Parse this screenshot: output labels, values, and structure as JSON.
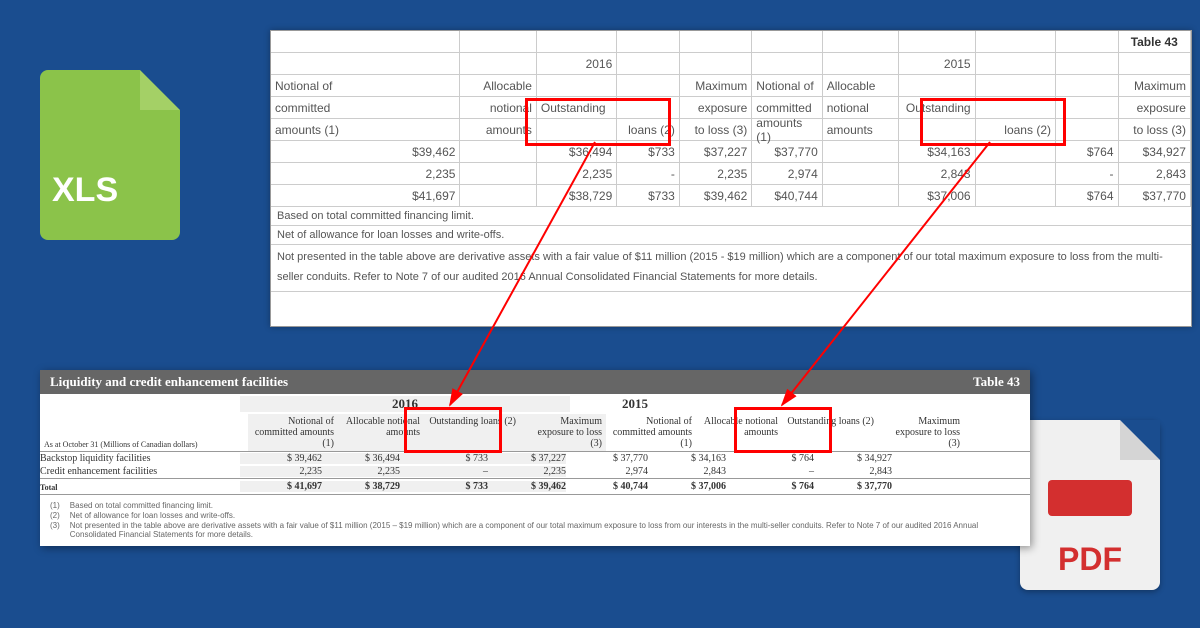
{
  "xls_label": "XLS",
  "pdf_label": "PDF",
  "top": {
    "table_label": "Table 43",
    "y1": "2016",
    "y2": "2015",
    "h": {
      "notional": "Notional of",
      "committed": "committed",
      "amounts1": "amounts (1)",
      "allocable": "Allocable",
      "notional_s": "notional",
      "amounts": "amounts",
      "outstanding": "Outstanding",
      "loans2": "loans (2)",
      "maximum": "Maximum",
      "exposure": "exposure",
      "loss3": "to loss (3)"
    },
    "r1": {
      "a": "$39,462",
      "b": "",
      "c": "$36,494",
      "d": "$733",
      "e": "$37,227",
      "f": "$37,770",
      "g": "",
      "h": "$34,163",
      "i": "$764",
      "j": "$34,927"
    },
    "r2": {
      "a": "2,235",
      "b": "",
      "c": "2,235",
      "d": "-",
      "e": "2,235",
      "f": "2,974",
      "g": "",
      "h": "2,843",
      "i": "-",
      "j": "2,843"
    },
    "r3": {
      "a": "$41,697",
      "b": "",
      "c": "$38,729",
      "d": "$733",
      "e": "$39,462",
      "f": "$40,744",
      "g": "",
      "h": "$37,006",
      "i": "$764",
      "j": "$37,770"
    },
    "n1": "Based on total committed financing limit.",
    "n2": "Net of allowance for loan losses and write-offs.",
    "n3": "Not presented in the table above are derivative assets with a fair value of $11 million (2015 - $19 million) which are a component of our total maximum exposure to loss from the multi-seller conduits. Refer to Note 7 of our audited 2016 Annual Consolidated Financial Statements for more details."
  },
  "bot": {
    "title": "Liquidity and credit enhancement facilities",
    "table_label": "Table 43",
    "y1": "2016",
    "y2": "2015",
    "asof": "As at October 31 (Millions of Canadian dollars)",
    "h": {
      "notional": "Notional of committed amounts",
      "allocable": "Allocable notional amounts",
      "outstanding": "Outstanding loans",
      "maximum": "Maximum exposure to loss",
      "s1": "(1)",
      "s2": "(2)",
      "s3": "(3)"
    },
    "r1": {
      "label": "Backstop liquidity facilities",
      "a": "$   39,462",
      "b": "$ 36,494",
      "c": "$         733",
      "d": "$  37,227",
      "e": "$   37,770",
      "f": "$ 34,163",
      "g": "$          764",
      "h": "$    34,927"
    },
    "r2": {
      "label": "Credit enhancement facilities",
      "a": "2,235",
      "b": "2,235",
      "c": "–",
      "d": "2,235",
      "e": "2,974",
      "f": "2,843",
      "g": "–",
      "h": "2,843"
    },
    "tot": {
      "label": "Total",
      "a": "$   41,697",
      "b": "$ 38,729",
      "c": "$         733",
      "d": "$ 39,462",
      "e": "$   40,744",
      "f": "$ 37,006",
      "g": "$          764",
      "h": "$    37,770"
    },
    "fn1": "Based on total committed financing limit.",
    "fn2": "Net of allowance for loan losses and write-offs.",
    "fn3": "Not presented in the table above are derivative assets with a fair value of $11 million (2015 – $19 million) which are a component of our total maximum exposure to loss from our interests in the multi-seller conduits. Refer to Note 7 of our audited 2016 Annual Consolidated Financial Statements for more details.",
    "fnlab": {
      "a": "(1)",
      "b": "(2)",
      "c": "(3)"
    }
  }
}
